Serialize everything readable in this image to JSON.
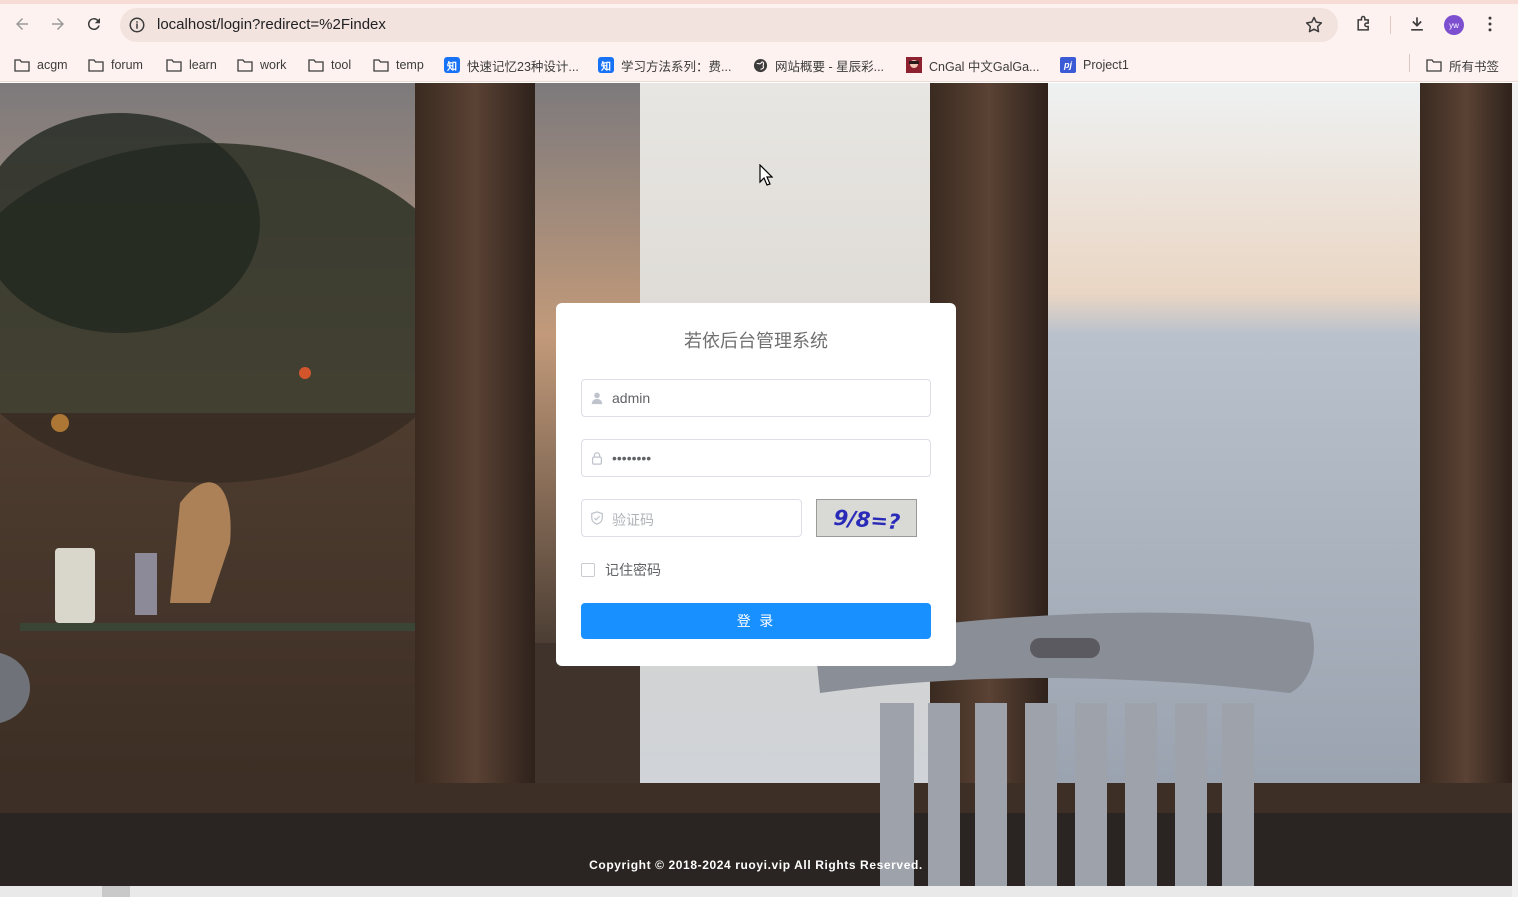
{
  "browser": {
    "url": "localhost/login?redirect=%2Findex",
    "avatar_initials": "yw",
    "bookmarks": [
      {
        "label": "acgm",
        "icon": "folder-icon"
      },
      {
        "label": "forum",
        "icon": "folder-icon"
      },
      {
        "label": "learn",
        "icon": "folder-icon"
      },
      {
        "label": "work",
        "icon": "folder-icon"
      },
      {
        "label": "tool",
        "icon": "folder-icon"
      },
      {
        "label": "temp",
        "icon": "folder-icon"
      },
      {
        "label": "快速记忆23种设计...",
        "icon": "zhihu-icon"
      },
      {
        "label": "学习方法系列：费...",
        "icon": "zhihu-icon"
      },
      {
        "label": "网站概要 - 星辰彩...",
        "icon": "globe-icon"
      },
      {
        "label": "CnGal 中文GalGa...",
        "icon": "cngal-icon"
      },
      {
        "label": "Project1",
        "icon": "project-icon"
      }
    ],
    "all_bookmarks": "所有书签",
    "zhihu_glyph": "知",
    "project_glyph": "pj"
  },
  "login": {
    "title": "若依后台管理系统",
    "username_value": "admin",
    "password_value": "••••••••",
    "captcha_placeholder": "验证码",
    "captcha_text": "9/8=?",
    "remember_label": "记住密码",
    "submit_label": "登 录"
  },
  "footer": {
    "copyright": "Copyright © 2018-2024 ruoyi.vip All Rights Reserved."
  },
  "colors": {
    "primary": "#1890ff",
    "chrome_bg": "#fdf2ef"
  }
}
